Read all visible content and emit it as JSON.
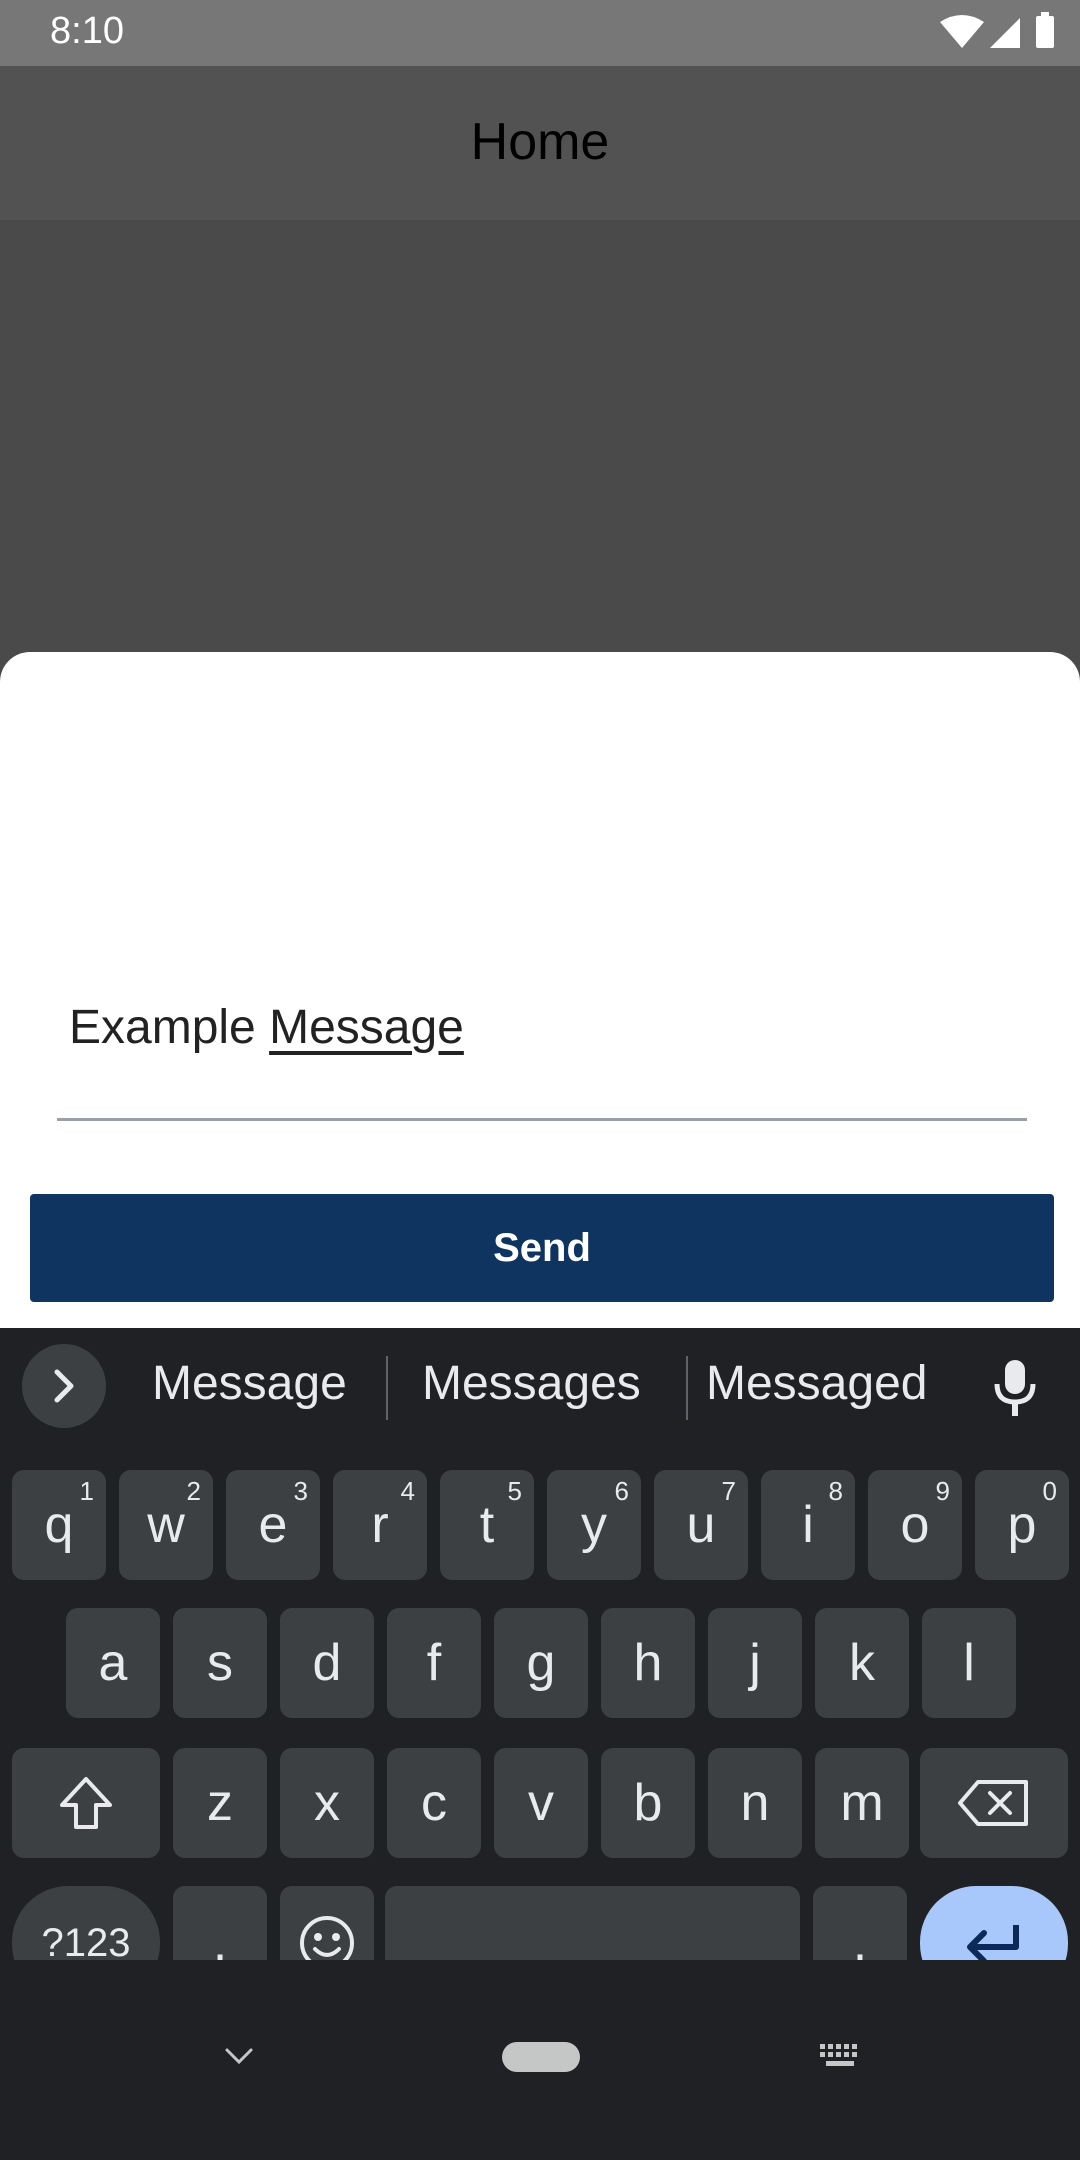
{
  "status_bar": {
    "time": "8:10",
    "icons": [
      "wifi-icon",
      "signal-icon",
      "battery-icon"
    ]
  },
  "app_bar": {
    "title": "Home"
  },
  "sheet": {
    "message": {
      "prefix": "Example ",
      "composing_word": "Message"
    },
    "send_label": "Send"
  },
  "keyboard": {
    "suggestions": [
      "Message",
      "Messages",
      "Messaged"
    ],
    "row1": [
      {
        "label": "q",
        "hint": "1"
      },
      {
        "label": "w",
        "hint": "2"
      },
      {
        "label": "e",
        "hint": "3"
      },
      {
        "label": "r",
        "hint": "4"
      },
      {
        "label": "t",
        "hint": "5"
      },
      {
        "label": "y",
        "hint": "6"
      },
      {
        "label": "u",
        "hint": "7"
      },
      {
        "label": "i",
        "hint": "8"
      },
      {
        "label": "o",
        "hint": "9"
      },
      {
        "label": "p",
        "hint": "0"
      }
    ],
    "row2": [
      "a",
      "s",
      "d",
      "f",
      "g",
      "h",
      "j",
      "k",
      "l"
    ],
    "row3": [
      "z",
      "x",
      "c",
      "v",
      "b",
      "n",
      "m"
    ],
    "symbols_label": "?123",
    "comma_label": ",",
    "period_label": ".",
    "colors": {
      "background": "#202124",
      "key": "#3c4043",
      "enter": "#a8c7fa",
      "send_button": "#0f3460"
    }
  }
}
